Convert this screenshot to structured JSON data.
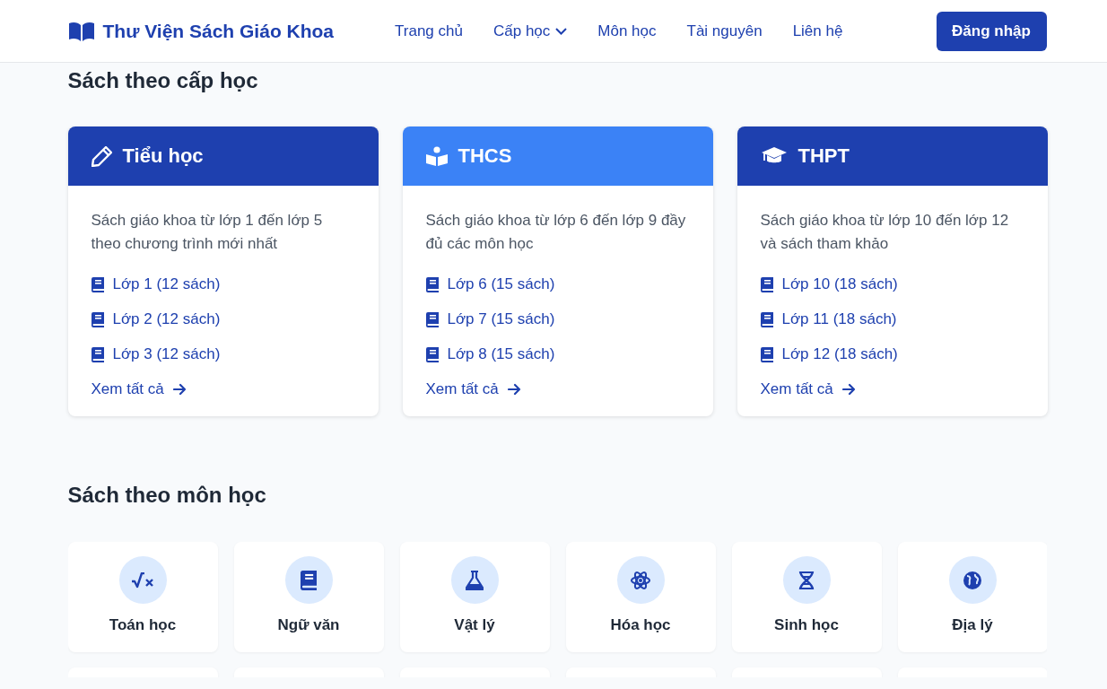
{
  "header": {
    "logo": "Thư Viện Sách Giáo Khoa",
    "nav": [
      {
        "label": "Trang chủ",
        "dropdown": false
      },
      {
        "label": "Cấp học",
        "dropdown": true
      },
      {
        "label": "Môn học",
        "dropdown": false
      },
      {
        "label": "Tài nguyên",
        "dropdown": false
      },
      {
        "label": "Liên hệ",
        "dropdown": false
      }
    ],
    "login": "Đăng nhập"
  },
  "levels_section": {
    "title": "Sách theo cấp học",
    "cards": [
      {
        "title": "Tiểu học",
        "color": "#1e40af",
        "description": "Sách giáo khoa từ lớp 1 đến lớp 5 theo chương trình mới nhất",
        "grades": [
          "Lớp 1 (12 sách)",
          "Lớp 2 (12 sách)",
          "Lớp 3 (12 sách)"
        ],
        "link": "Xem tất cả"
      },
      {
        "title": "THCS",
        "color": "#3b82f6",
        "description": "Sách giáo khoa từ lớp 6 đến lớp 9 đầy đủ các môn học",
        "grades": [
          "Lớp 6 (15 sách)",
          "Lớp 7 (15 sách)",
          "Lớp 8 (15 sách)"
        ],
        "link": "Xem tất cả"
      },
      {
        "title": "THPT",
        "color": "#1e40af",
        "description": "Sách giáo khoa từ lớp 10 đến lớp 12 và sách tham khảo",
        "grades": [
          "Lớp 10 (18 sách)",
          "Lớp 11 (18 sách)",
          "Lớp 12 (18 sách)"
        ],
        "link": "Xem tất cả"
      }
    ]
  },
  "subjects_section": {
    "title": "Sách theo môn học",
    "subjects": [
      {
        "kind": "subject",
        "name": "Toán học"
      },
      {
        "kind": "subject",
        "name": "Ngữ văn"
      },
      {
        "kind": "subject",
        "name": "Vật lý"
      },
      {
        "kind": "subject",
        "name": "Hóa học"
      },
      {
        "kind": "subject",
        "name": "Sinh học"
      },
      {
        "kind": "subject",
        "name": "Địa lý"
      },
      {
        "kind": "cut"
      },
      {
        "kind": "cut"
      },
      {
        "kind": "cut"
      },
      {
        "kind": "cut"
      },
      {
        "kind": "cut"
      },
      {
        "kind": "cut"
      }
    ]
  }
}
